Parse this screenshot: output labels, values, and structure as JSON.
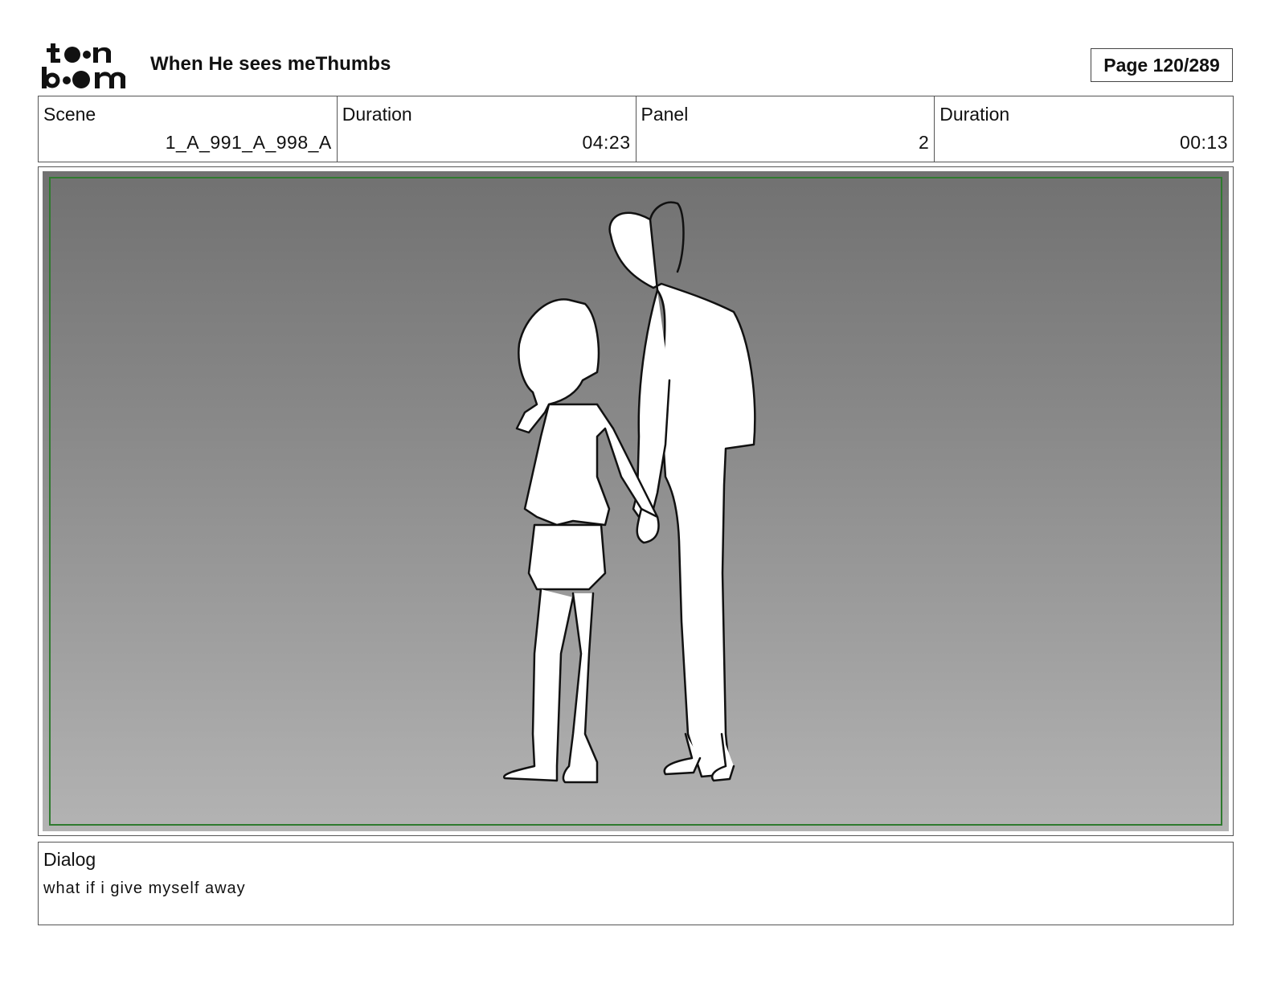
{
  "header": {
    "logo_text": "toon boom",
    "project_title": "When He sees meThumbs",
    "page_indicator": "Page 120/289"
  },
  "info": {
    "scene_label": "Scene",
    "scene_value": "1_A_991_A_998_A",
    "scene_duration_label": "Duration",
    "scene_duration_value": "04:23",
    "panel_label": "Panel",
    "panel_value": "2",
    "panel_duration_label": "Duration",
    "panel_duration_value": "00:13"
  },
  "dialog": {
    "label": "Dialog",
    "text": "what if i give myself away"
  },
  "colors": {
    "safe_frame": "#2f7a2f",
    "background_top": "#717171",
    "background_bottom": "#b3b3b3"
  }
}
